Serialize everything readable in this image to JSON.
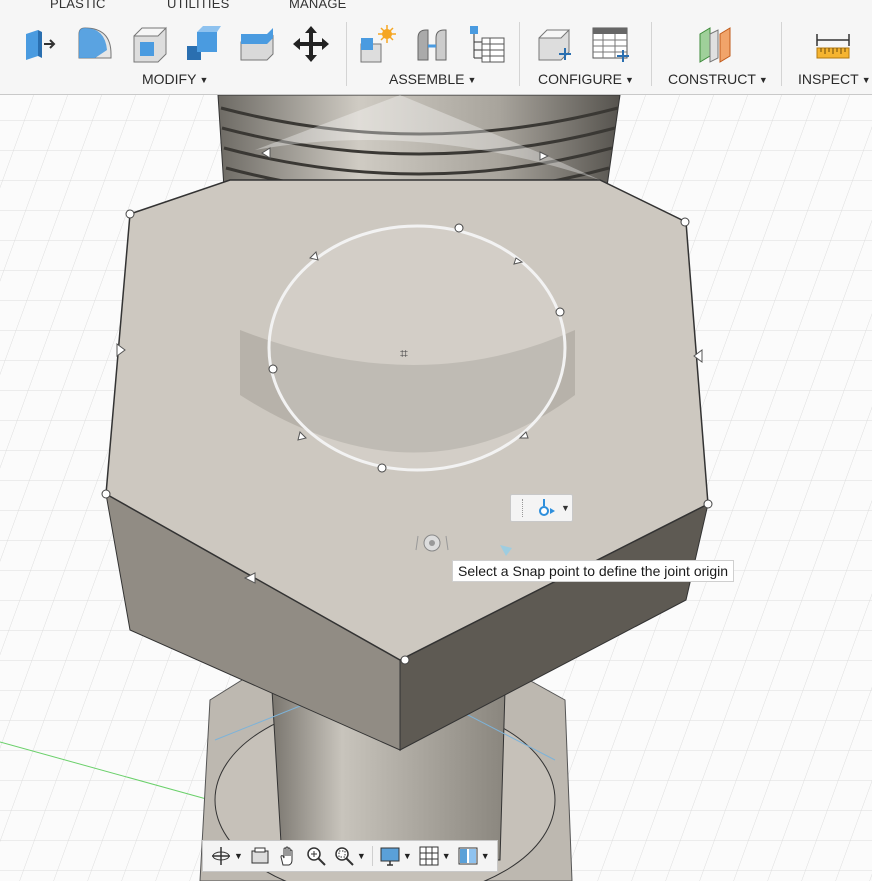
{
  "toolbar": {
    "tabs": [
      "PLASTIC",
      "UTILITIES",
      "MANAGE"
    ],
    "groups": [
      {
        "label": "MODIFY",
        "tools": [
          "press-pull-icon",
          "fillet-icon",
          "shell-icon",
          "combine-icon",
          "offset-face-icon",
          "move-icon"
        ]
      },
      {
        "label": "ASSEMBLE",
        "tools": [
          "new-component-icon",
          "joint-icon",
          "bill-of-materials-icon"
        ]
      },
      {
        "label": "CONFIGURE",
        "tools": [
          "configure-component-icon",
          "configuration-table-icon"
        ]
      },
      {
        "label": "CONSTRUCT",
        "tools": [
          "midplane-icon"
        ]
      },
      {
        "label": "INSPECT",
        "tools": [
          "measure-icon"
        ]
      }
    ]
  },
  "viewport": {
    "tooltip": "Select a Snap point to define the joint origin",
    "mini_toolbar_icon": "joint-origin-snap-icon"
  },
  "navigation_bar": {
    "tools": [
      "orbit-icon",
      "look-at-icon",
      "pan-icon",
      "zoom-icon",
      "zoom-window-icon",
      "display-settings-icon",
      "grid-icon",
      "viewports-icon"
    ]
  },
  "colors": {
    "toolbar_bg": "#f6f6f6",
    "grid_line": "#d8d8d8",
    "model_top": "#cfcbc3",
    "model_side": "#8a857d",
    "thread_dark": "#4a4843",
    "accent_blue": "#2e8fdc"
  }
}
